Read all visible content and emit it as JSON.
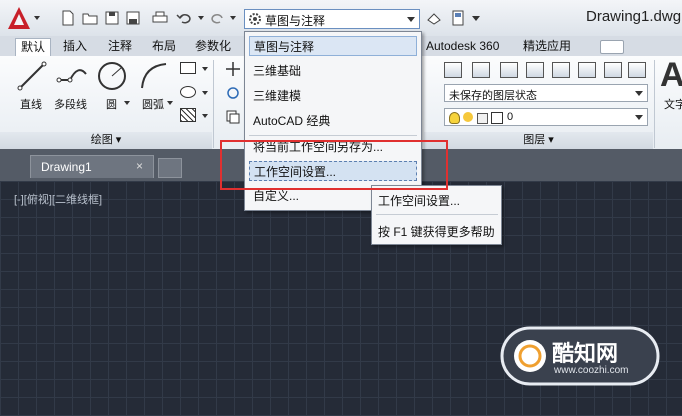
{
  "app": {
    "title": "Drawing1.dwg",
    "workspace_current": "草图与注释"
  },
  "ribbon_tabs": [
    "默认",
    "插入",
    "注释",
    "布局",
    "参数化",
    "Autodesk 360",
    "精选应用"
  ],
  "ribbon": {
    "draw_tools": [
      "直线",
      "多段线",
      "圆",
      "圆弧"
    ],
    "draw_panel_label": "绘图",
    "layer_state": "未保存的图层状态",
    "layer_value": "0",
    "layer_panel_label": "图层",
    "text_label": "文字"
  },
  "document": {
    "tab_label": "Drawing1",
    "viewport_label": "[-][俯视][二维线框]"
  },
  "workspace_menu": {
    "items": [
      "草图与注释",
      "三维基础",
      "三维建模",
      "AutoCAD 经典"
    ],
    "save_as": "将当前工作空间另存为...",
    "settings": "工作空间设置...",
    "customize": "自定义..."
  },
  "submenu": {
    "items": [
      "工作空间设置...",
      "按 F1 键获得更多帮助"
    ]
  },
  "watermark": {
    "name": "酷知网",
    "url": "www.coozhi.com"
  },
  "colors": {
    "accent_red": "#e03030",
    "canvas_bg": "#252b37"
  }
}
